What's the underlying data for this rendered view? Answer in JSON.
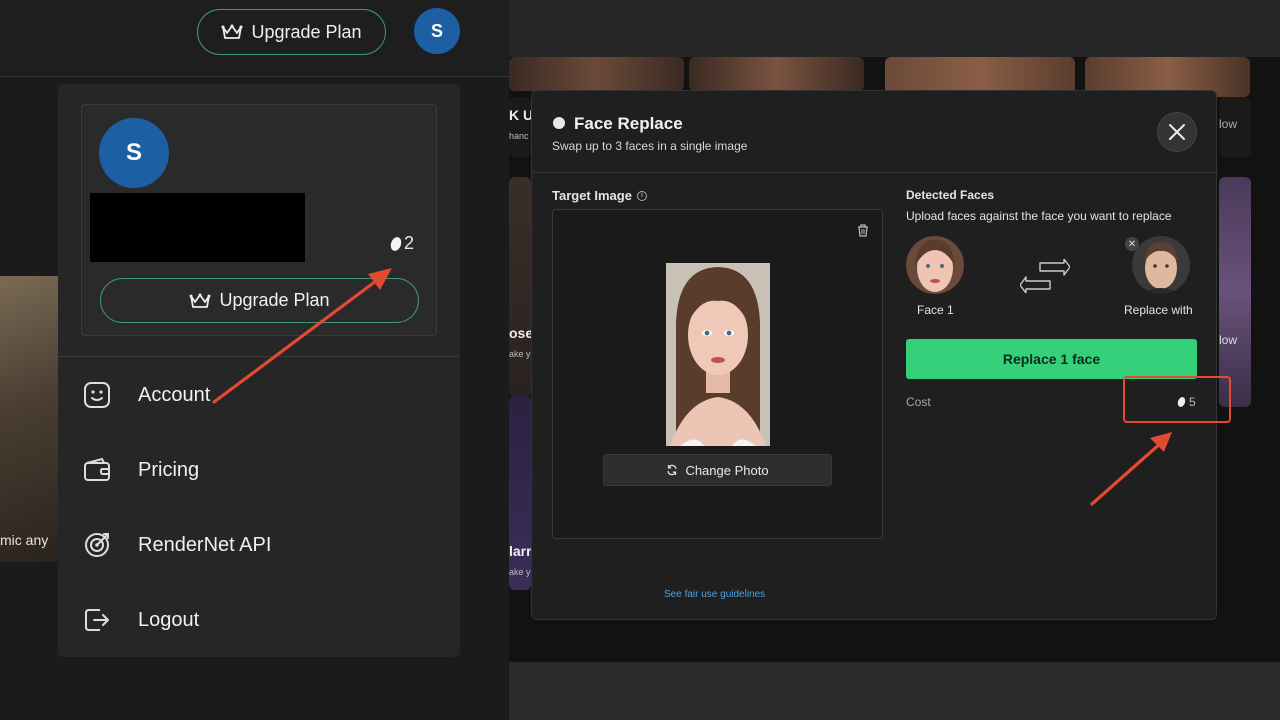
{
  "topbar": {
    "upgrade_label": "Upgrade Plan",
    "avatar_initial": "S"
  },
  "background_left_caption": "mic any",
  "profile": {
    "avatar_initial": "S",
    "credits": "2",
    "upgrade_label": "Upgrade Plan"
  },
  "menu": {
    "items": [
      {
        "label": "Account",
        "icon": "smiley-icon"
      },
      {
        "label": "Pricing",
        "icon": "wallet-icon"
      },
      {
        "label": "RenderNet API",
        "icon": "target-icon"
      },
      {
        "label": "Logout",
        "icon": "logout-icon"
      }
    ]
  },
  "background_right": {
    "captions": [
      "K U",
      "hanc",
      "ose",
      "ake y",
      "larr",
      "ake y",
      "low",
      "low"
    ]
  },
  "modal": {
    "title": "Face Replace",
    "subtitle": "Swap up to 3 faces in a single image",
    "target_label": "Target Image",
    "change_photo_label": "Change Photo",
    "fair_use_link": "See fair use guidelines",
    "detected_label": "Detected Faces",
    "detected_sub": "Upload faces against the face you want to replace",
    "face1_caption": "Face 1",
    "replace_with_caption": "Replace with",
    "replace_button": "Replace 1 face",
    "cost_label": "Cost",
    "cost_value": "5"
  },
  "colors": {
    "accent_green": "#34d07a",
    "outline_green": "#3e9b78",
    "avatar_blue": "#1d5fa3",
    "annotation_red": "#e24a32",
    "link_blue": "#4aa3df"
  }
}
